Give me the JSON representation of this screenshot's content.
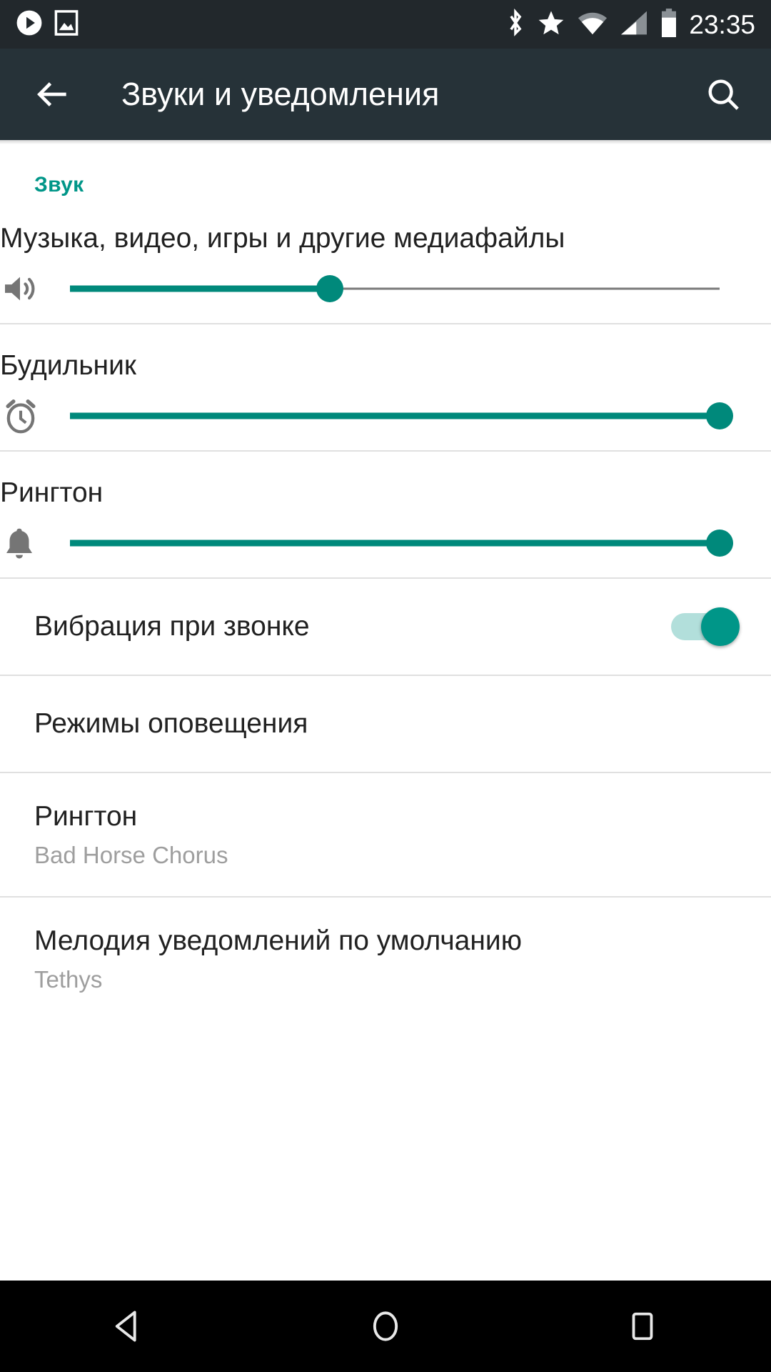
{
  "statusbar": {
    "clock": "23:35",
    "left_icons": [
      "play-circle-icon",
      "screenshot-image-icon"
    ],
    "right_icons": [
      "bluetooth-icon",
      "priority-star-icon",
      "wifi-icon",
      "cellular-signal-icon",
      "battery-icon"
    ]
  },
  "toolbar": {
    "back_label": "back-arrow-icon",
    "title": "Звуки и уведомления",
    "search_label": "search-icon"
  },
  "sound_section": {
    "header": "Звук",
    "sliders": [
      {
        "label": "Музыка, видео, игры и другие медиафайлы",
        "icon": "volume-up-icon",
        "value": 40
      },
      {
        "label": "Будильник",
        "icon": "alarm-clock-icon",
        "value": 100
      },
      {
        "label": "Рингтон",
        "icon": "bell-icon",
        "value": 100
      }
    ],
    "items": [
      {
        "title": "Вибрация при звонке",
        "subtitle": "",
        "control": "toggle",
        "toggle_on": true
      },
      {
        "title": "Режимы оповещения",
        "subtitle": "",
        "control": "none",
        "toggle_on": false
      },
      {
        "title": "Рингтон",
        "subtitle": "Bad Horse Chorus",
        "control": "none",
        "toggle_on": false
      },
      {
        "title": "Мелодия уведомлений по умолчанию",
        "subtitle": "Tethys",
        "control": "none",
        "toggle_on": false
      }
    ]
  },
  "navbar": {
    "back": "nav-back-icon",
    "home": "nav-home-icon",
    "recents": "nav-recents-icon"
  },
  "colors": {
    "accent": "#009688",
    "slider_fill": "#00897b",
    "toolbar_bg": "#263238",
    "statusbar_bg": "#22282c"
  }
}
